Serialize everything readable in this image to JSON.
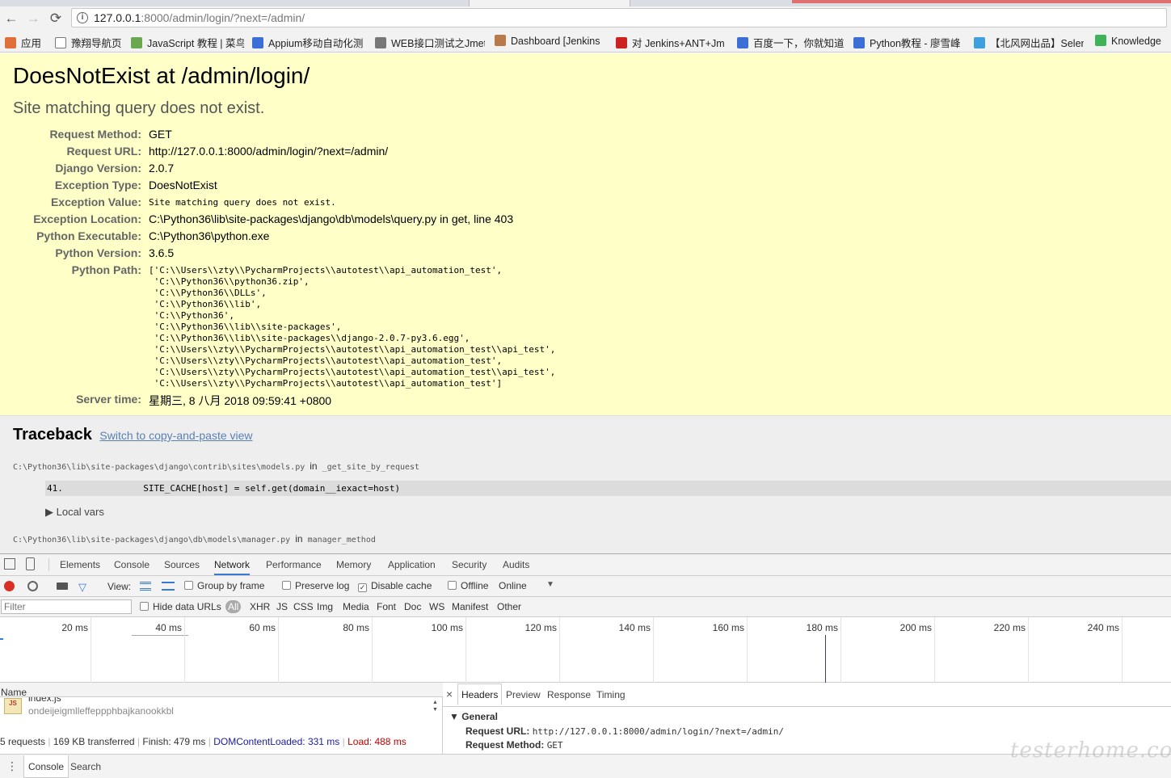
{
  "browser": {
    "url_host": "127.0.0.1",
    "url_rest": ":8000/admin/login/?next=/admin/",
    "back_icon": "←",
    "forward_icon": "→",
    "reload_icon": "⟳",
    "bookmarks": [
      {
        "label": "应用",
        "color": "#e0703a"
      },
      {
        "label": "豫翔导航页",
        "color": "#ffffff"
      },
      {
        "label": "JavaScript 教程 | 菜鸟",
        "color": "#6aa84f"
      },
      {
        "label": "Appium移动自动化测",
        "color": "#3b6fd6"
      },
      {
        "label": "WEB接口测试之Jmet",
        "color": "#777777"
      },
      {
        "label": "Dashboard [Jenkins",
        "color": "#b87a4b"
      },
      {
        "label": "对 Jenkins+ANT+Jm",
        "color": "#cc2222"
      },
      {
        "label": "百度一下，你就知道",
        "color": "#3b6fd6"
      },
      {
        "label": "Python教程 - 廖雪峰",
        "color": "#3b6fd6"
      },
      {
        "label": "【北风网出品】Selen",
        "color": "#3fa0e0"
      },
      {
        "label": "Knowledge",
        "color": "#3fb35a"
      }
    ]
  },
  "error": {
    "title": "DoesNotExist at /admin/login/",
    "subtitle": "Site matching query does not exist.",
    "meta": [
      {
        "key": "Request Method:",
        "value": "GET",
        "mono": false
      },
      {
        "key": "Request URL:",
        "value": "http://127.0.0.1:8000/admin/login/?next=/admin/",
        "mono": false
      },
      {
        "key": "Django Version:",
        "value": "2.0.7",
        "mono": false
      },
      {
        "key": "Exception Type:",
        "value": "DoesNotExist",
        "mono": false
      },
      {
        "key": "Exception Value:",
        "value": "Site matching query does not exist.",
        "mono": true
      },
      {
        "key": "Exception Location:",
        "value": "C:\\Python36\\lib\\site-packages\\django\\db\\models\\query.py in get, line 403",
        "mono": false
      },
      {
        "key": "Python Executable:",
        "value": "C:\\Python36\\python.exe",
        "mono": false
      },
      {
        "key": "Python Version:",
        "value": "3.6.5",
        "mono": false
      },
      {
        "key": "Python Path:",
        "value": "",
        "mono": false
      }
    ],
    "python_path": "['C:\\\\Users\\\\zty\\\\PycharmProjects\\\\autotest\\\\api_automation_test',\n 'C:\\\\Python36\\\\python36.zip',\n 'C:\\\\Python36\\\\DLLs',\n 'C:\\\\Python36\\\\lib',\n 'C:\\\\Python36',\n 'C:\\\\Python36\\\\lib\\\\site-packages',\n 'C:\\\\Python36\\\\lib\\\\site-packages\\\\django-2.0.7-py3.6.egg',\n 'C:\\\\Users\\\\zty\\\\PycharmProjects\\\\autotest\\\\api_automation_test\\\\api_test',\n 'C:\\\\Users\\\\zty\\\\PycharmProjects\\\\autotest\\\\api_automation_test',\n 'C:\\\\Users\\\\zty\\\\PycharmProjects\\\\autotest\\\\api_automation_test\\\\api_test',\n 'C:\\\\Users\\\\zty\\\\PycharmProjects\\\\autotest\\\\api_automation_test']",
    "server_time_key": "Server time:",
    "server_time": "星期三, 8 八月 2018 09:59:41 +0800"
  },
  "traceback": {
    "title": "Traceback",
    "switch_link": "Switch to copy-and-paste view",
    "frames": [
      {
        "file": "C:\\Python36\\lib\\site-packages\\django\\contrib\\sites\\models.py",
        "in": "in",
        "func": "_get_site_by_request"
      },
      {
        "file": "C:\\Python36\\lib\\site-packages\\django\\db\\models\\manager.py",
        "in": "in",
        "func": "manager_method"
      }
    ],
    "context_line": "41.               SITE_CACHE[host] = self.get(domain__iexact=host)",
    "local_vars": "▶ Local vars"
  },
  "devtools": {
    "tabs": [
      "Elements",
      "Console",
      "Sources",
      "Network",
      "Performance",
      "Memory",
      "Application",
      "Security",
      "Audits"
    ],
    "active_tab": "Network",
    "toolbar": {
      "view_label": "View:",
      "group_by_frame": "Group by frame",
      "preserve_log": "Preserve log",
      "disable_cache": "Disable cache",
      "offline": "Offline",
      "throttle": "Online",
      "throttle_arrow": "▼"
    },
    "filter": {
      "placeholder": "Filter",
      "hide_data_urls": "Hide data URLs",
      "types": [
        "All",
        "XHR",
        "JS",
        "CSS",
        "Img",
        "Media",
        "Font",
        "Doc",
        "WS",
        "Manifest",
        "Other"
      ]
    },
    "timeline_ticks": [
      "20 ms",
      "40 ms",
      "60 ms",
      "80 ms",
      "100 ms",
      "120 ms",
      "140 ms",
      "160 ms",
      "180 ms",
      "200 ms",
      "220 ms",
      "240 ms"
    ],
    "name_header": "Name",
    "request": {
      "name": "index.js",
      "sub": "ondeijeigmlleffeppphbajkanookkbl",
      "icon": "JS"
    },
    "status": {
      "requests": "5 requests",
      "transferred": "169 KB transferred",
      "finish": "Finish: 479 ms",
      "dcl": "DOMContentLoaded: 331 ms",
      "load": "Load: 488 ms"
    },
    "detail_tabs": [
      "Headers",
      "Preview",
      "Response",
      "Timing"
    ],
    "close_icon": "×",
    "general": {
      "title": "▼ General",
      "url_key": "Request URL:",
      "url_val": "http://127.0.0.1:8000/admin/login/?next=/admin/",
      "method_key": "Request Method:",
      "method_val": "GET"
    },
    "drawer": {
      "menu_icon": "⋮",
      "tabs": [
        "Console",
        "Search"
      ]
    }
  },
  "colors": {
    "summary_bg": "#ffffc8",
    "accent": "#3879d9",
    "dcl": "#1a1aa6",
    "load": "#c80000"
  },
  "watermark": "testerhome.com"
}
